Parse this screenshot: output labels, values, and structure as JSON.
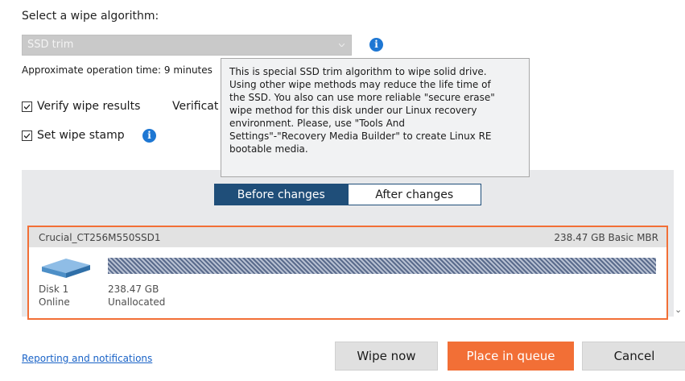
{
  "heading": "Select a wipe algorithm:",
  "algorithm": {
    "selected": "SSD trim"
  },
  "approx_time": "Approximate operation time: 9 minutes",
  "options": {
    "verify": {
      "label": "Verify wipe results",
      "checked": true
    },
    "verification_label": "Verificat",
    "stamp": {
      "label": "Set wipe stamp",
      "checked": true
    }
  },
  "tooltip": {
    "lines": [
      "This is special SSD trim algorithm to wipe solid drive.",
      "Using other wipe methods may reduce the life time of",
      "the SSD. You also can use more reliable \"secure erase\"",
      "wipe method for this disk under our Linux recovery",
      "environment. Please, use \"Tools And",
      "Settings\"-\"Recovery Media Builder\" to create Linux RE",
      "bootable media."
    ]
  },
  "view_toggle": {
    "before": "Before changes",
    "after": "After changes",
    "active": "before"
  },
  "disk": {
    "model": "Crucial_CT256M550SSD1",
    "summary": "238.47 GB Basic MBR",
    "name": "Disk 1",
    "status": "Online",
    "partition_size": "238.47 GB",
    "partition_state": "Unallocated"
  },
  "footer": {
    "link": "Reporting and notifications",
    "wipe_now": "Wipe now",
    "place_in_queue": "Place in queue",
    "cancel": "Cancel"
  },
  "colors": {
    "accent": "#f26f36",
    "toggle_active": "#1f4e79",
    "info": "#1e77d3"
  },
  "icons": {
    "info": "info-icon",
    "disk": "disk-drive-icon",
    "chevron": "chevron-down-icon"
  }
}
